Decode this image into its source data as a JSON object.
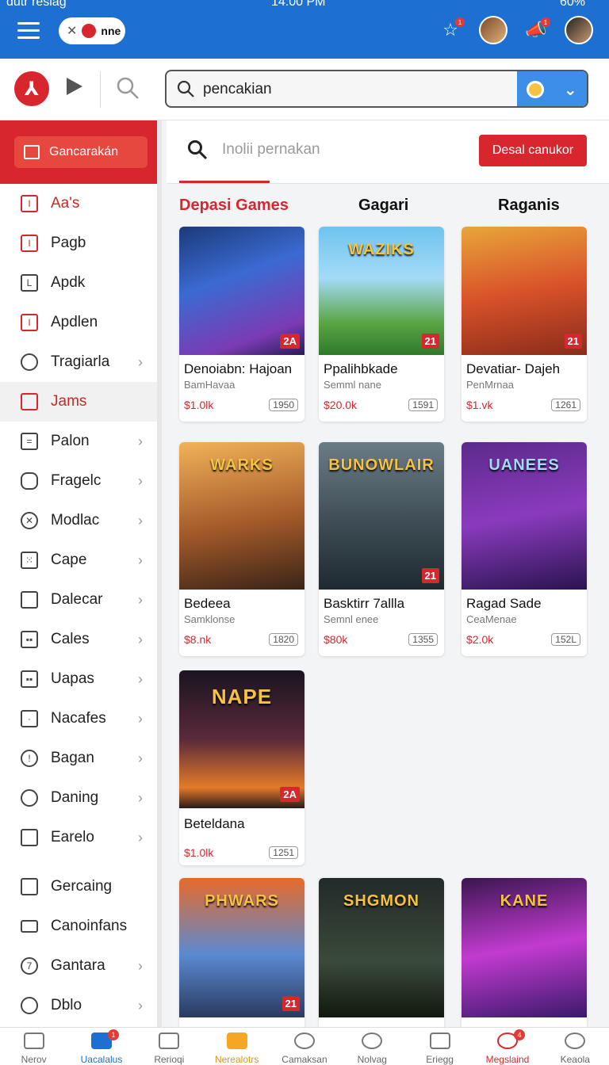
{
  "status": {
    "left": "dutr resiag",
    "time": "14:00 PM",
    "battery": "60%"
  },
  "header": {
    "pill_label": "nne",
    "notif_count_1": "1",
    "notif_count_2": "1"
  },
  "search": {
    "value": "pencakian"
  },
  "sidebar": {
    "head_button": "Gancarakán",
    "items": [
      {
        "label": "Aa's"
      },
      {
        "label": "Pagb"
      },
      {
        "label": "Apdk"
      },
      {
        "label": "Apdlen"
      },
      {
        "label": "Tragiarla"
      },
      {
        "label": "Jams"
      },
      {
        "label": "Palon"
      },
      {
        "label": "Fragelc"
      },
      {
        "label": "Modlac"
      },
      {
        "label": "Cape"
      },
      {
        "label": "Dalecar"
      },
      {
        "label": "Cales"
      },
      {
        "label": "Uapas"
      },
      {
        "label": "Nacafes"
      },
      {
        "label": "Bagan"
      },
      {
        "label": "Daning"
      },
      {
        "label": "Earelo"
      },
      {
        "label": "Gercaing"
      },
      {
        "label": "Canoinfans"
      },
      {
        "label": "Gantara"
      },
      {
        "label": "Dblo"
      }
    ]
  },
  "content": {
    "search_placeholder": "Inolii pernakan",
    "cta_label": "Desal canukor",
    "columns": [
      "Depasi Games",
      "Gagari",
      "Raganis"
    ]
  },
  "cards": [
    {
      "art_label": "",
      "badge": "2A",
      "title": "Denoiabn: Hajoan",
      "sub": "BamHavaa",
      "price": "$1.0lk",
      "count": "1950"
    },
    {
      "art_label": "WAZIKS",
      "badge": "21",
      "title": "Ppalihbkade",
      "sub": "Semml nane",
      "price": "$20.0k",
      "count": "1591"
    },
    {
      "art_label": "",
      "badge": "21",
      "title": "Devatiar- Dajeh",
      "sub": "PenMrnaa",
      "price": "$1.vk",
      "count": "1261"
    },
    {
      "art_label": "WARKS",
      "badge": "",
      "title": "Bedeea",
      "sub": "Samklonse",
      "price": "$8.nk",
      "count": "1820"
    },
    {
      "art_label": "BUNOWLAIR",
      "badge": "21",
      "title": "Basktirr 7allla",
      "sub": "Semnl enee",
      "price": "$80k",
      "count": "1355"
    },
    {
      "art_label": "UANEES",
      "badge": "",
      "title": "Ragad Sade",
      "sub": "CeaMenae",
      "price": "$2.0k",
      "count": "152L"
    },
    {
      "art_label": "NAPE",
      "badge": "2A",
      "title": "Beteldana",
      "sub": "",
      "price": "$1.0lk",
      "count": "1251"
    },
    {
      "art_label": "PHWARS",
      "badge": "21",
      "title": "",
      "sub": "",
      "price": "",
      "count": ""
    },
    {
      "art_label": "SHGMON",
      "badge": "",
      "title": "",
      "sub": "",
      "price": "",
      "count": ""
    },
    {
      "art_label": "KANE",
      "badge": "",
      "title": "",
      "sub": "",
      "price": "",
      "count": ""
    }
  ],
  "bottom_nav": [
    {
      "label": "Nerov"
    },
    {
      "label": "Uacalalus",
      "badge": "1"
    },
    {
      "label": "Rerioqi"
    },
    {
      "label": "Nerealotrs"
    },
    {
      "label": "Camaksan"
    },
    {
      "label": "Nolvag"
    },
    {
      "label": "Eriegg"
    },
    {
      "label": "Megslaind",
      "badge": "4"
    },
    {
      "label": "Keaola"
    }
  ]
}
